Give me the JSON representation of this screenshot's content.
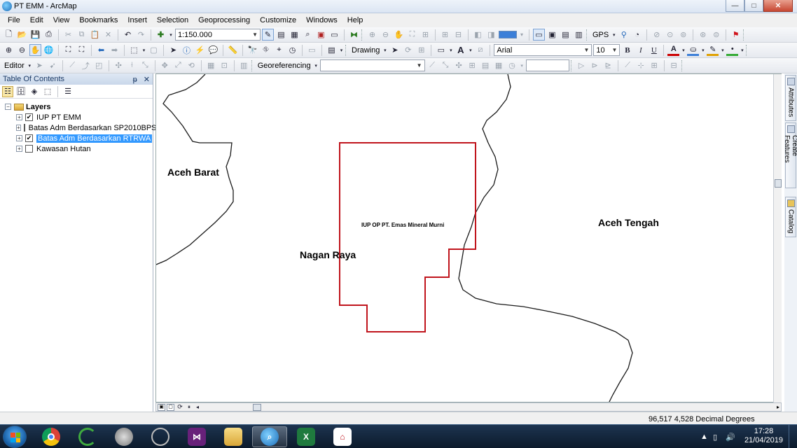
{
  "window": {
    "title": "PT EMM - ArcMap",
    "min_glyph": "—",
    "max_glyph": "□",
    "close_glyph": "✕"
  },
  "menu": [
    "File",
    "Edit",
    "View",
    "Bookmarks",
    "Insert",
    "Selection",
    "Geoprocessing",
    "Customize",
    "Windows",
    "Help"
  ],
  "toolbar": {
    "scale_value": "1:150.000",
    "gps_label": "GPS",
    "drawing_label": "Drawing",
    "font_name": "Arial",
    "font_size": "10",
    "bold": "B",
    "italic": "I",
    "underline": "U",
    "font_color_glyph": "A",
    "text_glyph": "A",
    "editor_label": "Editor",
    "georeferencing_label": "Georeferencing",
    "colors": {
      "fill": "#3c7fd8",
      "font": "#cc0000",
      "line": "#e0a000",
      "marker": "#33aa33"
    }
  },
  "toc": {
    "title": "Table Of Contents",
    "pin_glyph": "ᵽ",
    "close_glyph": "✕",
    "root_label": "Layers",
    "layers": [
      {
        "label": "IUP PT EMM",
        "checked": true,
        "selected": false
      },
      {
        "label": "Batas Adm Berdasarkan SP2010BPS",
        "checked": false,
        "selected": false
      },
      {
        "label": "Batas Adm Berdasarkan RTRWA",
        "checked": true,
        "selected": true
      },
      {
        "label": "Kawasan Hutan",
        "checked": false,
        "selected": false
      }
    ]
  },
  "map": {
    "labels": {
      "aceh_barat": "Aceh Barat",
      "nagan_raya": "Nagan Raya",
      "aceh_tengah": "Aceh Tengah",
      "iup_label": "IUP OP PT. Emas Mineral Murni"
    },
    "boundary_color": "#1a1a1a",
    "iup_color": "#c0141c"
  },
  "dock": {
    "attributes": "Attributes",
    "create_features": "Create Features",
    "catalog": "Catalog"
  },
  "status": {
    "coords": "96,517  4,528 Decimal Degrees"
  },
  "taskbar": {
    "time": "17:28",
    "date": "21/04/2019"
  }
}
